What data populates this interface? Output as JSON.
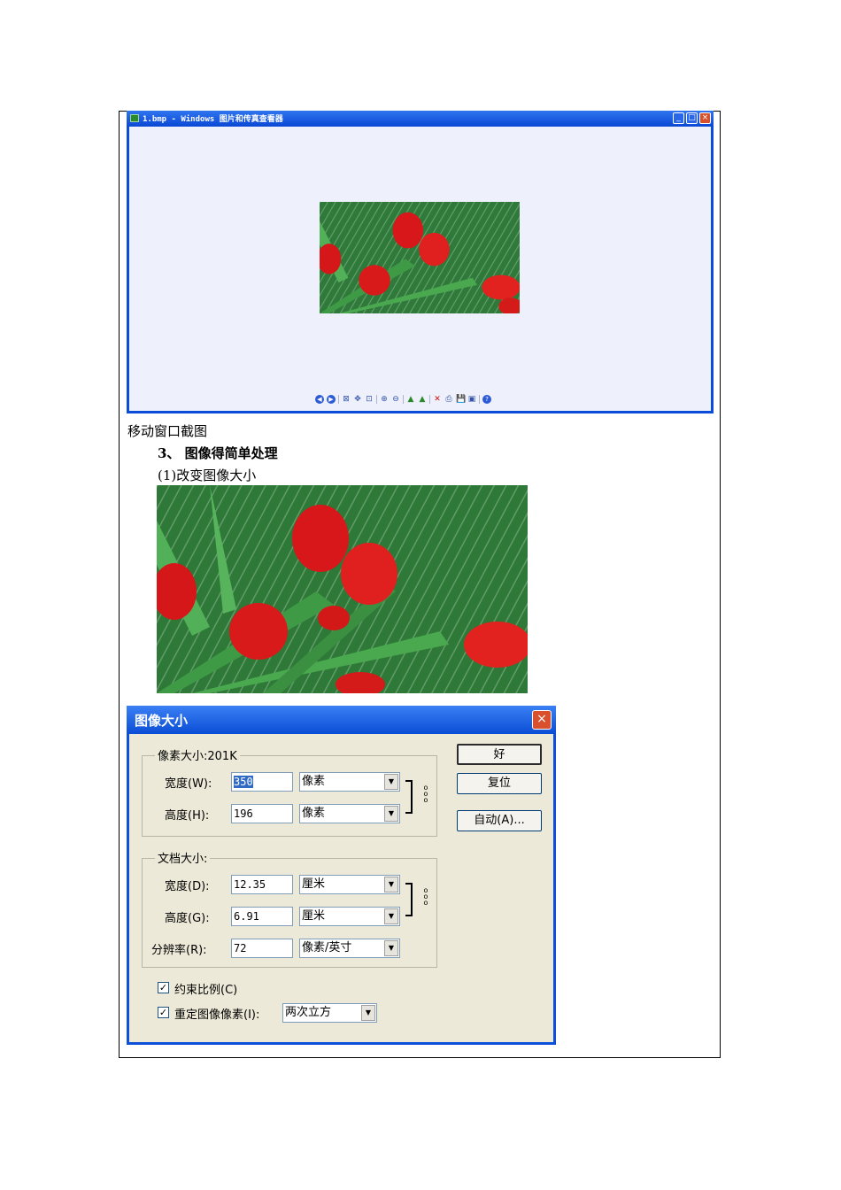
{
  "viewer": {
    "title": "1.bmp - Windows 图片和传真查看器",
    "min": "_",
    "max": "□",
    "close": "×",
    "toolbar": [
      "◀",
      "▶",
      "⊠",
      "✥",
      "⊡",
      "⊕",
      "⊖",
      "▲",
      "▲",
      "✕",
      "⎙",
      "💾",
      "▣",
      "?"
    ]
  },
  "doc": {
    "caption": "移动窗口截图",
    "heading": "3、 图像得简单处理",
    "subheading": "(1)改变图像大小"
  },
  "dialog": {
    "title": "图像大小",
    "close": "×",
    "pixel_group_label": "像素大小:201K",
    "width_label": "宽度(W):",
    "height_label": "高度(H):",
    "pixel_width": "350",
    "pixel_height": "196",
    "pixel_unit": "像素",
    "doc_group_label": "文档大小:",
    "doc_width_label": "宽度(D):",
    "doc_height_label": "高度(G):",
    "resolution_label": "分辨率(R):",
    "doc_width": "12.35",
    "doc_height": "6.91",
    "resolution": "72",
    "doc_unit": "厘米",
    "resolution_unit": "像素/英寸",
    "ok": "好",
    "reset": "复位",
    "auto": "自动(A)...",
    "constrain_label": "约束比例(C)",
    "resample_label": "重定图像像素(I):",
    "resample_method": "两次立方",
    "checked": "✓",
    "arrow": "▼"
  }
}
